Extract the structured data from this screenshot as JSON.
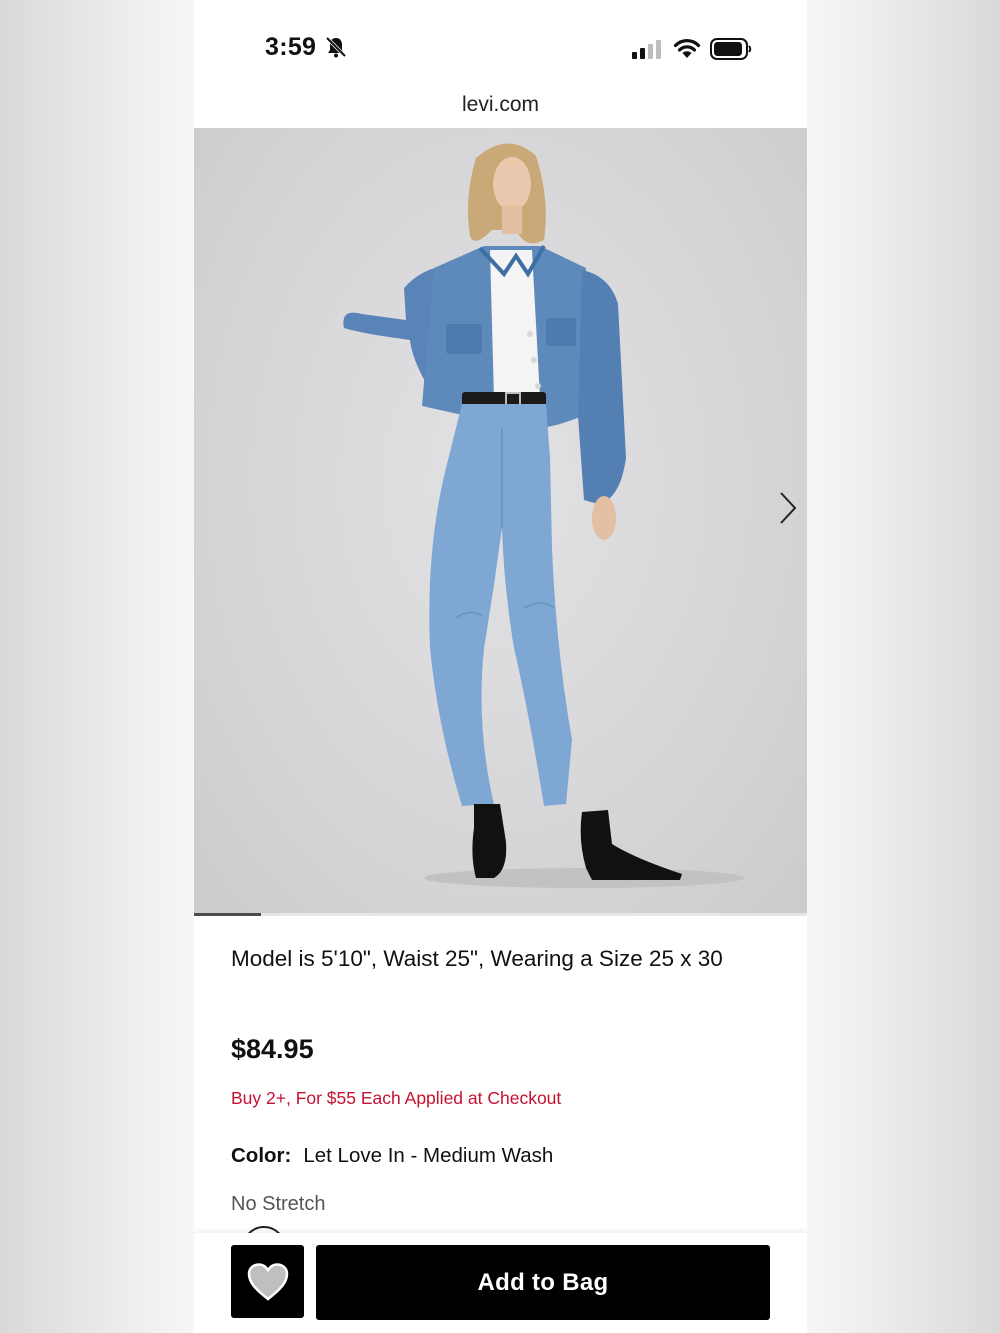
{
  "status_bar": {
    "time": "3:59",
    "silent_icon": "bell-slash-icon",
    "signal_icon": "cellular-signal-icon",
    "wifi_icon": "wifi-icon",
    "battery_icon": "battery-icon"
  },
  "browser": {
    "url": "levi.com"
  },
  "gallery": {
    "image": "model wearing denim trucker jacket, white tee and light-wash barrel jeans with black boots",
    "next_icon": "chevron-right-icon",
    "progress": 0.11
  },
  "product": {
    "model_info": "Model is 5'10\", Waist 25\", Wearing a Size 25 x 30",
    "price": "$84.95",
    "promo": "Buy 2+, For $55 Each Applied at Checkout",
    "color_label": "Color:",
    "color_value": "Let Love In - Medium Wash",
    "stretch": "No Stretch"
  },
  "actions": {
    "wishlist_icon": "heart-icon",
    "add_to_bag_label": "Add to Bag"
  },
  "colors": {
    "promo": "#c41230",
    "button": "#000000",
    "denim": "#5a84b7"
  }
}
